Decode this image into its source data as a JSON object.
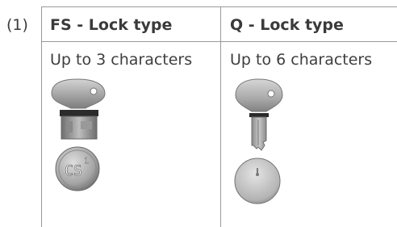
{
  "row_number": "(1)",
  "columns": [
    {
      "title": "FS - Lock type",
      "subtitle": "Up to 3 characters",
      "images": {
        "key": "key-with-lock-cylinder",
        "face": "cylinder-face",
        "face_text": "CS",
        "face_sup": "1"
      }
    },
    {
      "title": "Q - Lock type",
      "subtitle": "Up to 6 characters",
      "images": {
        "key": "flat-key",
        "face": "round-disc"
      }
    }
  ]
}
